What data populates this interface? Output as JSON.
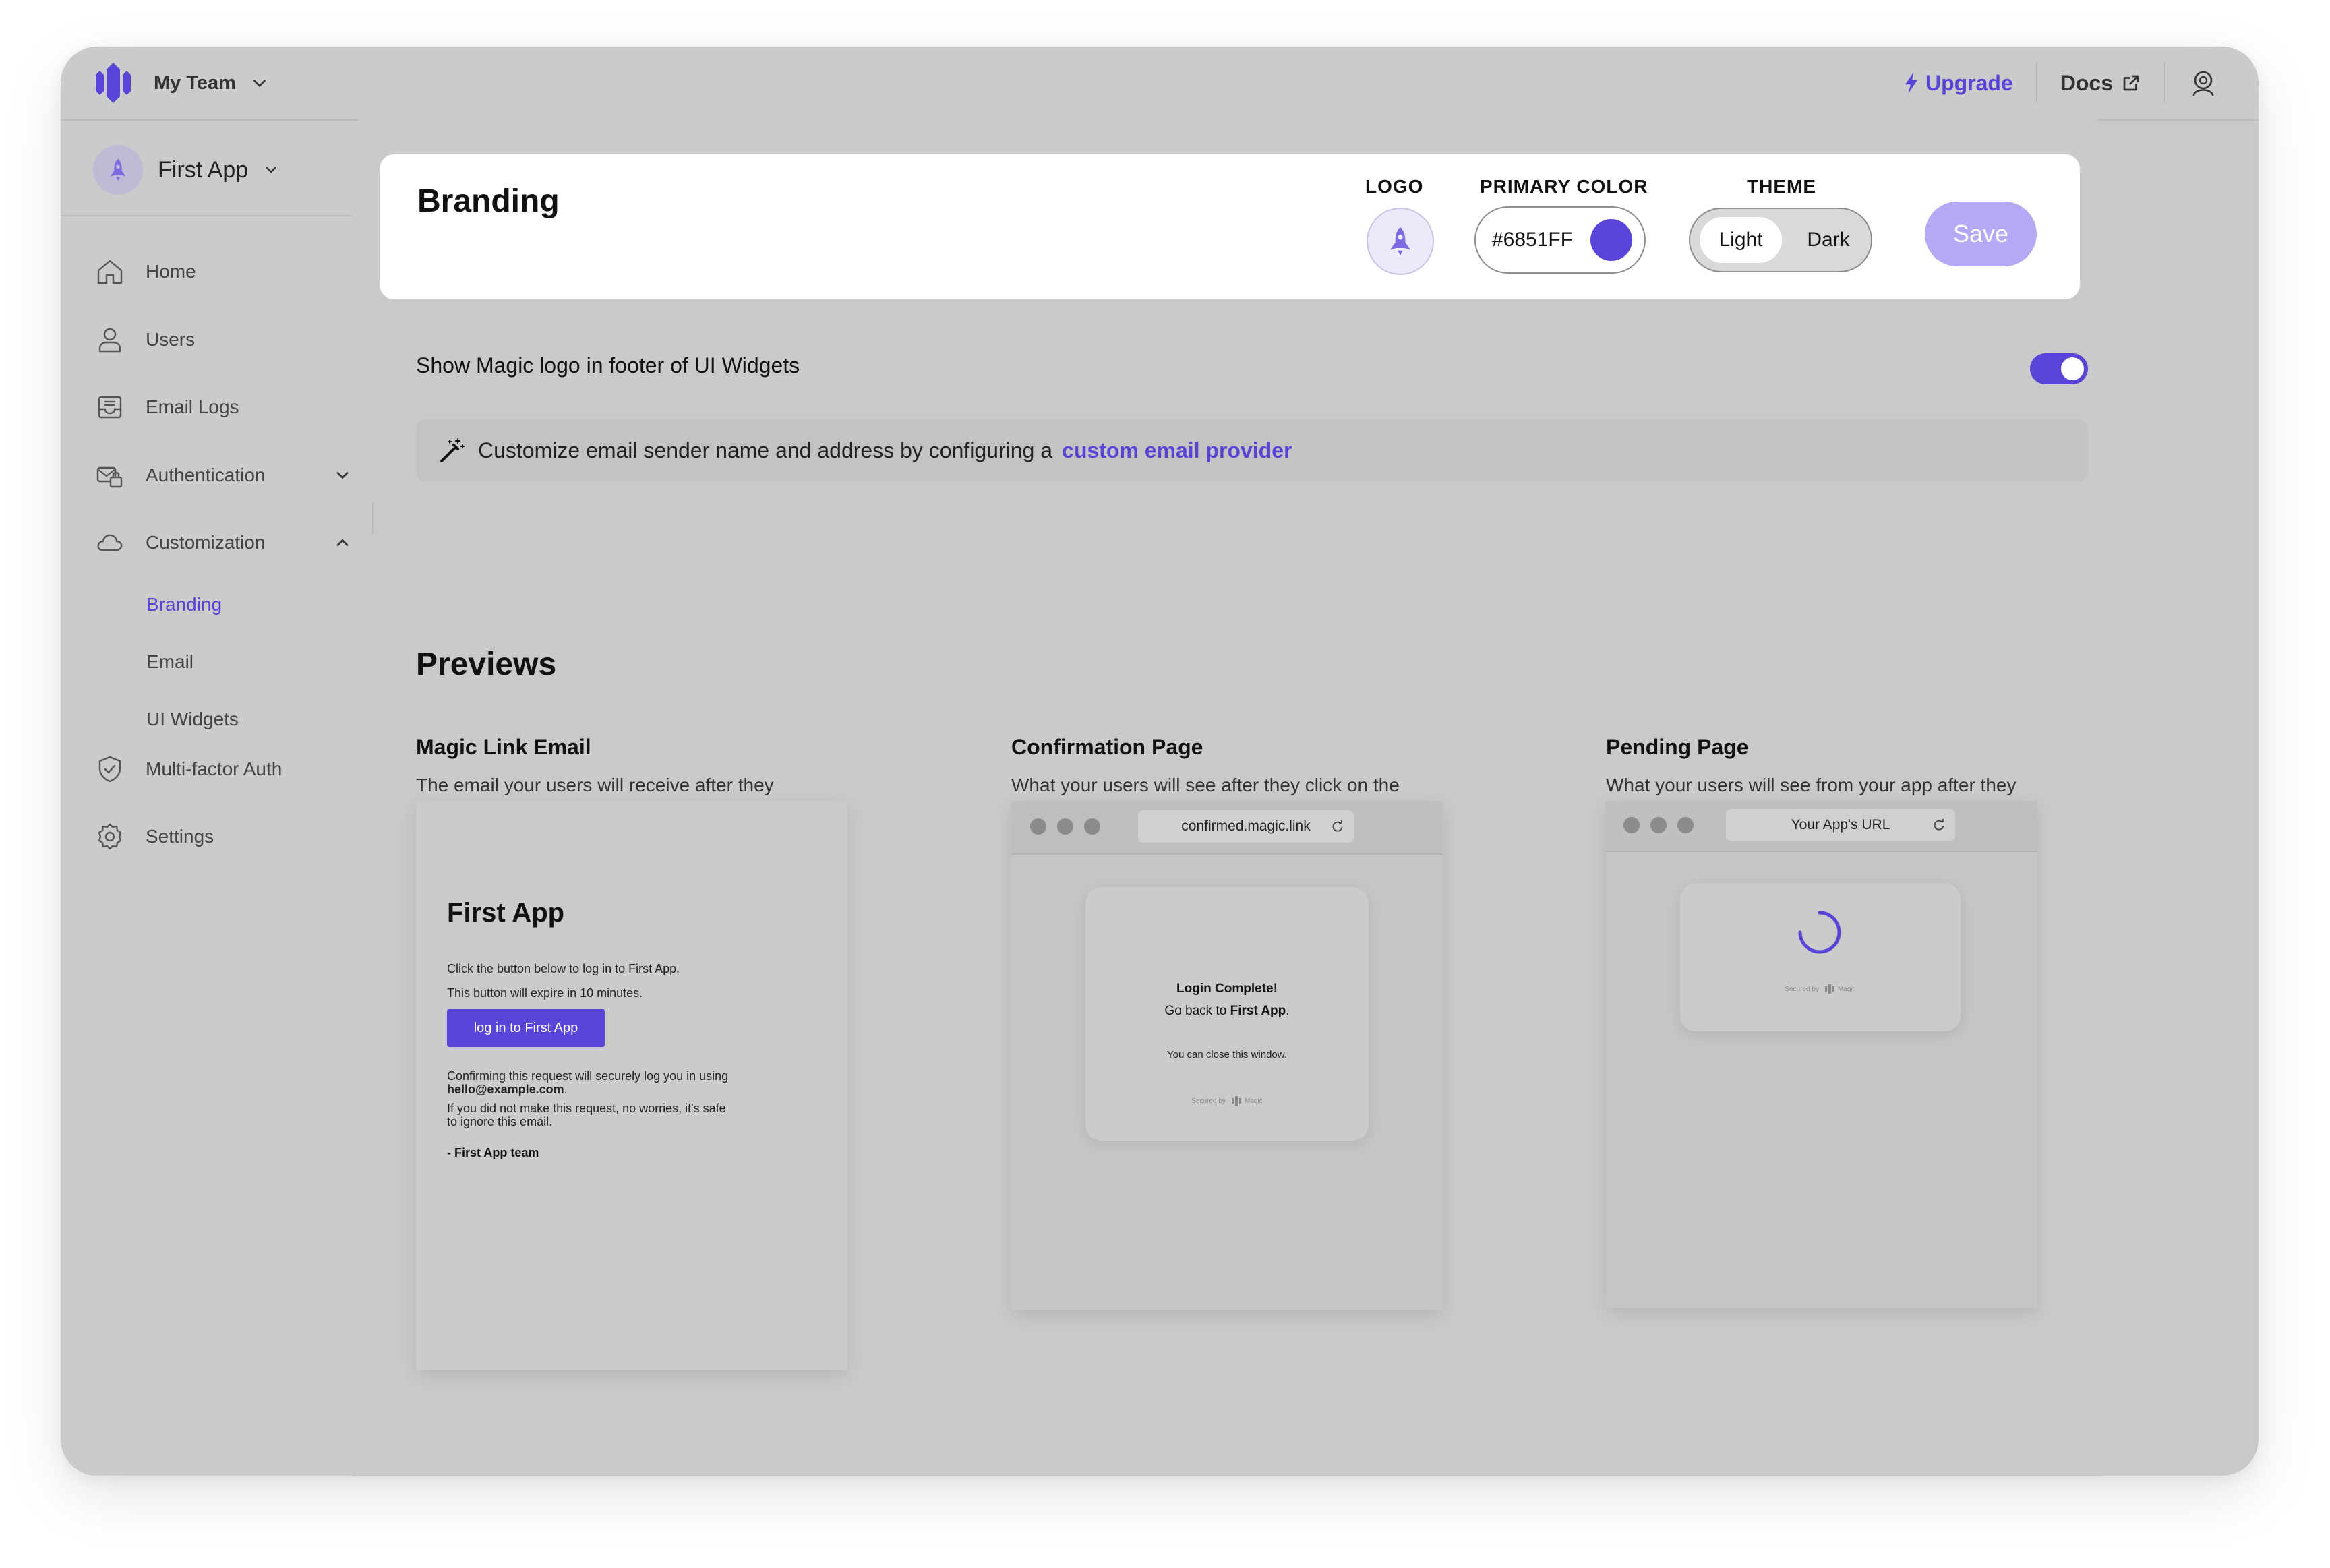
{
  "colors": {
    "accent": "#5845d8",
    "save_disabled": "#b3a9f5",
    "primary_swatch": "#5845d8"
  },
  "topbar": {
    "team_name": "My Team",
    "upgrade_label": "Upgrade",
    "docs_label": "Docs"
  },
  "sidebar": {
    "app_name": "First App",
    "items": [
      {
        "label": "Home",
        "icon": "home-icon"
      },
      {
        "label": "Users",
        "icon": "user-icon"
      },
      {
        "label": "Email Logs",
        "icon": "inbox-icon"
      },
      {
        "label": "Authentication",
        "icon": "auth-icon",
        "expanded": false
      },
      {
        "label": "Customization",
        "icon": "cloud-icon",
        "expanded": true
      },
      {
        "label": "Multi-factor Auth",
        "icon": "shield-icon"
      },
      {
        "label": "Settings",
        "icon": "gear-icon"
      }
    ],
    "sub_items": [
      {
        "label": "Branding",
        "active": true
      },
      {
        "label": "Email",
        "active": false
      },
      {
        "label": "UI Widgets",
        "active": false
      }
    ]
  },
  "branding": {
    "title": "Branding",
    "logo_label": "LOGO",
    "primary_color_label": "PRIMARY COLOR",
    "primary_color_value": "#6851FF",
    "theme_label": "THEME",
    "theme_options": [
      "Light",
      "Dark"
    ],
    "theme_selected": "Light",
    "save_label": "Save",
    "toggle_label": "Show Magic logo in footer of UI Widgets",
    "toggle_on": true,
    "info_text": "Customize email sender name and address by configuring a",
    "info_link": "custom email provider"
  },
  "previews": {
    "title": "Previews",
    "email": {
      "title": "Magic Link Email",
      "desc": "The email your users will receive after they submit their email address",
      "app_name": "First App",
      "line1": "Click the button below to log in to First App.",
      "line2": "This button will expire in 10 minutes.",
      "button": "log in to First App",
      "confirm_text": "Confirming this request will securely log you in using",
      "confirm_email": "hello@example.com",
      "ignore_text": "If you did not make this request, no worries, it's safe to ignore this email.",
      "signoff": "- First App team"
    },
    "confirmation": {
      "title": "Confirmation Page",
      "desc": "What your users will see after they click on the Magic Link",
      "url": "confirmed.magic.link",
      "login_complete": "Login Complete!",
      "go_back_prefix": "Go back to",
      "go_back_app": "First App",
      "close_text": "You can close this window.",
      "secured_by": "Secured by",
      "secured_brand": "Magic"
    },
    "pending": {
      "title": "Pending Page",
      "desc": "What your users will see from your app after they request a Magic Link email",
      "url": "Your App's URL",
      "secured_by": "Secured by",
      "secured_brand": "Magic"
    }
  }
}
